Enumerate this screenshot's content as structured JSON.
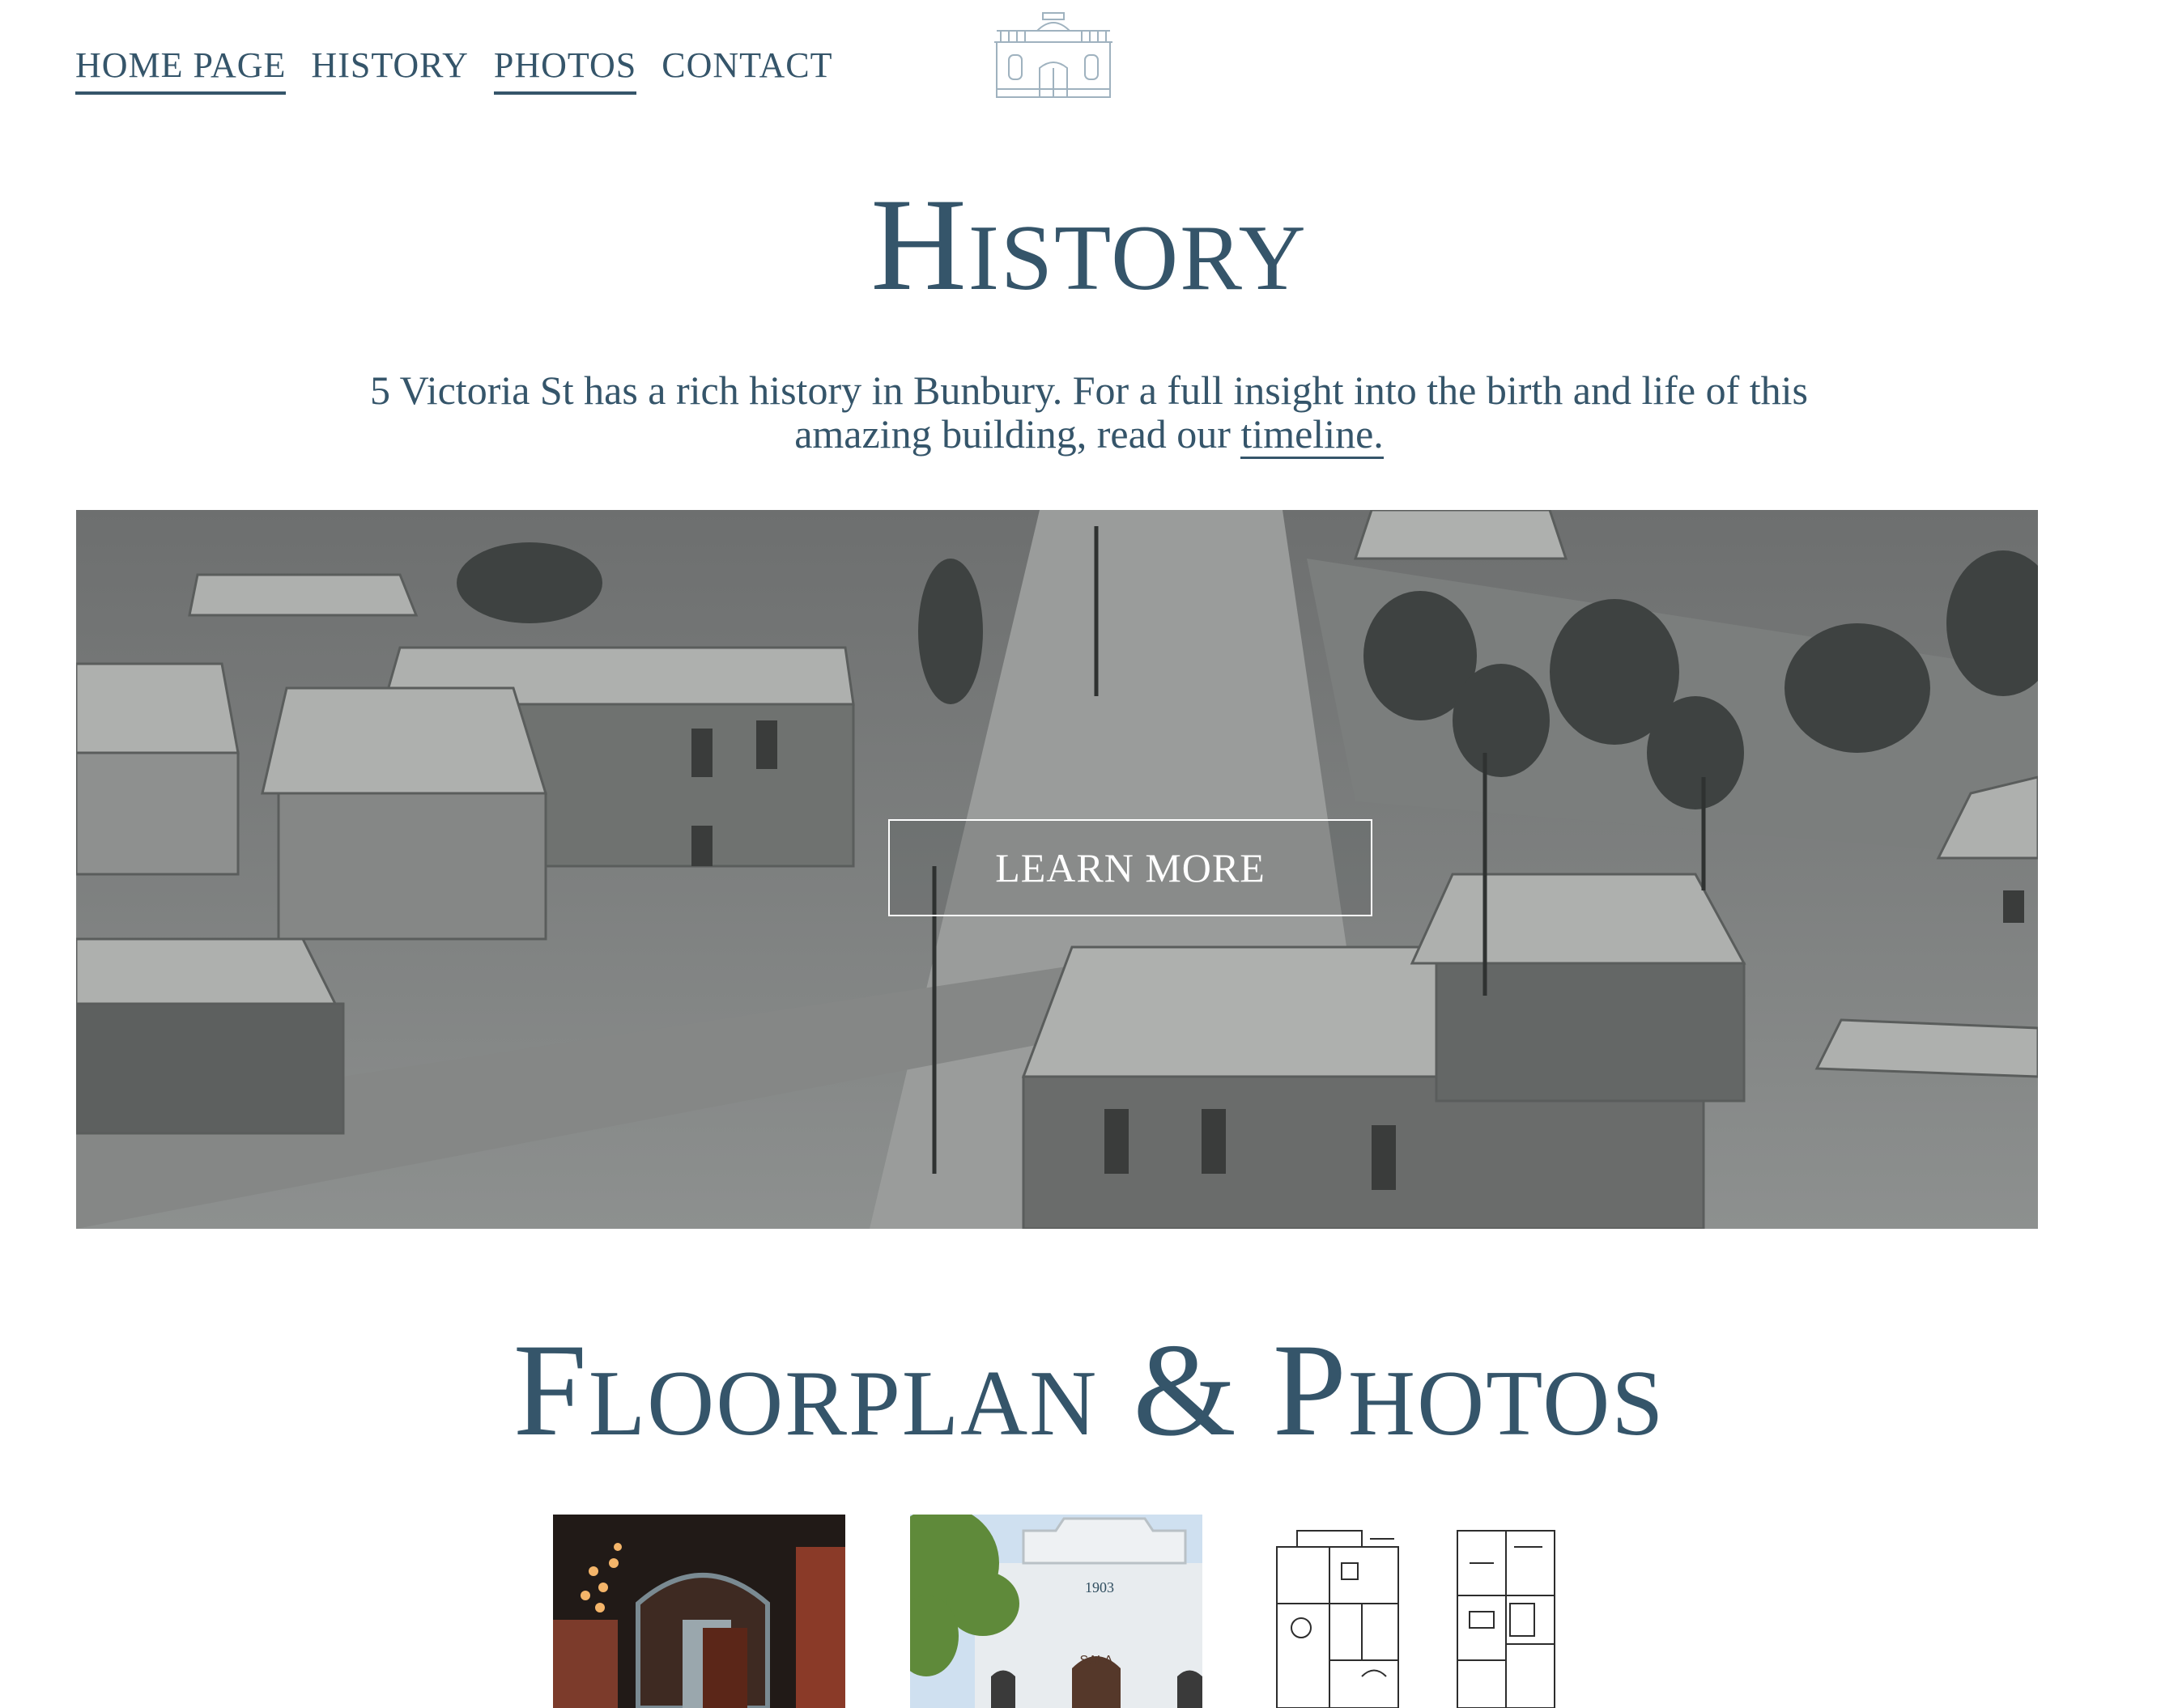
{
  "nav": {
    "items": [
      {
        "label": "HOME PAGE",
        "active": true
      },
      {
        "label": "HISTORY",
        "active": false
      },
      {
        "label": "PHOTOS",
        "active": true
      },
      {
        "label": "CONTACT",
        "active": false
      }
    ]
  },
  "history": {
    "title": "History",
    "intro_text": "5 Victoria St has a rich history in Bunbury. For a full insight into the birth and life of this amazing building, read our ",
    "intro_link": "timeline."
  },
  "banner": {
    "button_label": "LEARN MORE"
  },
  "floorplan": {
    "title": "Floorplan & Photos",
    "thumbnails": [
      {
        "name": "interior-arch-photo"
      },
      {
        "name": "facade-1903-photo",
        "facade_year": "1903",
        "facade_sign": "SALA"
      },
      {
        "name": "floorplan-ground"
      },
      {
        "name": "floorplan-upper"
      }
    ]
  },
  "colors": {
    "brand": "#35556a",
    "background": "#ffffff"
  }
}
